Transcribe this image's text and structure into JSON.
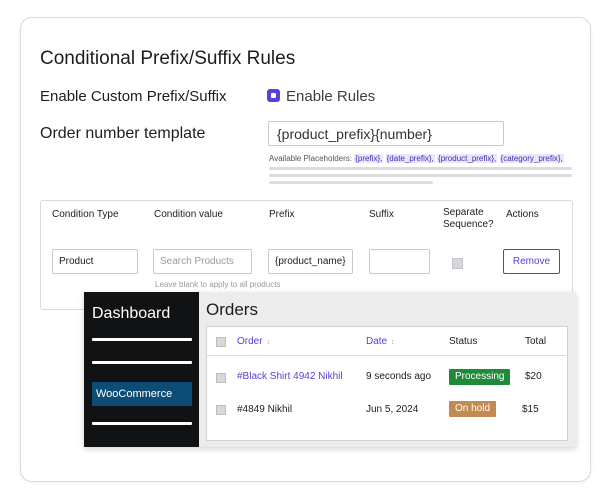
{
  "settings": {
    "title": "Conditional Prefix/Suffix Rules",
    "enable_label": "Enable Custom Prefix/Suffix",
    "enable_checkbox_label": "Enable Rules",
    "enable_checked": true,
    "template_label": "Order number template",
    "template_value": "{product_prefix}{number}",
    "placeholders_label": "Available Placeholders:",
    "placeholders": [
      "{prefix},",
      "{date_prefix},",
      "{product_prefix},",
      "{category_prefix},"
    ]
  },
  "rules_table": {
    "headers": [
      "Condition Type",
      "Condition value",
      "Prefix",
      "Suffix",
      "Separate Sequence?",
      "Actions"
    ],
    "row": {
      "condition_type": "Product",
      "condition_value_placeholder": "Search Products",
      "prefix": "{product_name}",
      "suffix": "",
      "separate_sequence": false,
      "action_label": "Remove",
      "hint": "Leave blank to apply to all products"
    }
  },
  "wp_admin": {
    "sidebar_title": "Dashboard",
    "active_item": "WooCommerce",
    "page_title": "Orders",
    "headers": {
      "order": "Order",
      "date": "Date",
      "status": "Status",
      "total": "Total"
    },
    "sort_icon": "↕",
    "orders": [
      {
        "order": "#Black Shirt 4942 Nikhil",
        "date": "9 seconds ago",
        "status": "Processing",
        "status_color": "#1e8a3a",
        "total": "$20"
      },
      {
        "order": "#4849 Nikhil",
        "date": "Jun 5, 2024",
        "status": "On hold",
        "status_color": "#c38b4f",
        "total": "$15"
      }
    ]
  },
  "colors": {
    "accent": "#5a3fd6",
    "sidebar": "#111214",
    "woo_active": "#0d4d75"
  }
}
